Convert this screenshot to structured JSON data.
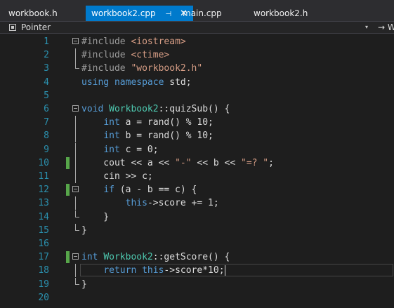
{
  "tabs": [
    {
      "label": "workbook.h",
      "active": false
    },
    {
      "label": "workbook2.cpp",
      "active": true,
      "pin": "⊣",
      "close": "✕"
    },
    {
      "label": "main.cpp",
      "active": false
    },
    {
      "label": "workbook2.h",
      "active": false
    }
  ],
  "navbar": {
    "scope_label": "Pointer",
    "dropdown_glyph": "▾",
    "right_label": "→ W"
  },
  "colors": {
    "accent": "#007acc",
    "background": "#1e1e1e",
    "line_number": "#2b91af",
    "keyword": "#569cd6",
    "type": "#4ec9b0",
    "string": "#d69d85",
    "preprocessor": "#9b9b9b",
    "change_marker": "#57a64a"
  },
  "icons": {
    "navbar_icon": "type-icon",
    "fold_icon": "collapse-icon",
    "tab_pin": "pin-icon",
    "tab_close": "close-icon"
  },
  "lines": [
    {
      "n": "1",
      "tokens": [
        {
          "t": "#include ",
          "c": "pp"
        },
        {
          "t": "<iostream>",
          "c": "str"
        }
      ],
      "fold": "box"
    },
    {
      "n": "2",
      "tokens": [
        {
          "t": "#include ",
          "c": "pp"
        },
        {
          "t": "<ctime>",
          "c": "str"
        }
      ],
      "fold": "line"
    },
    {
      "n": "3",
      "tokens": [
        {
          "t": "#include ",
          "c": "pp"
        },
        {
          "t": "\"workbook2.h\"",
          "c": "str"
        }
      ],
      "fold": "end"
    },
    {
      "n": "4",
      "tokens": [
        {
          "t": "using",
          "c": "kw"
        },
        {
          "t": " ",
          "c": "plain"
        },
        {
          "t": "namespace",
          "c": "kw"
        },
        {
          "t": " std;",
          "c": "plain"
        }
      ]
    },
    {
      "n": "5",
      "tokens": []
    },
    {
      "n": "6",
      "tokens": [
        {
          "t": "void",
          "c": "kw"
        },
        {
          "t": " ",
          "c": "plain"
        },
        {
          "t": "Workbook2",
          "c": "type"
        },
        {
          "t": "::quizSub() {",
          "c": "plain"
        }
      ],
      "fold": "box"
    },
    {
      "n": "7",
      "tokens": [
        {
          "t": "    ",
          "c": "plain"
        },
        {
          "t": "int",
          "c": "kw"
        },
        {
          "t": " a = rand() % 10;",
          "c": "plain"
        }
      ],
      "fold": "line"
    },
    {
      "n": "8",
      "tokens": [
        {
          "t": "    ",
          "c": "plain"
        },
        {
          "t": "int",
          "c": "kw"
        },
        {
          "t": " b = rand() % 10;",
          "c": "plain"
        }
      ],
      "fold": "line"
    },
    {
      "n": "9",
      "tokens": [
        {
          "t": "    ",
          "c": "plain"
        },
        {
          "t": "int",
          "c": "kw"
        },
        {
          "t": " c = 0;",
          "c": "plain"
        }
      ],
      "fold": "line"
    },
    {
      "n": "10",
      "tokens": [
        {
          "t": "    cout << a << ",
          "c": "plain"
        },
        {
          "t": "\"-\"",
          "c": "str"
        },
        {
          "t": " << b << ",
          "c": "plain"
        },
        {
          "t": "\"=? \"",
          "c": "str"
        },
        {
          "t": ";",
          "c": "plain"
        }
      ],
      "fold": "line",
      "changed": true
    },
    {
      "n": "11",
      "tokens": [
        {
          "t": "    cin >> c;",
          "c": "plain"
        }
      ],
      "fold": "line"
    },
    {
      "n": "12",
      "tokens": [
        {
          "t": "    ",
          "c": "plain"
        },
        {
          "t": "if",
          "c": "kw"
        },
        {
          "t": " (a - b == c) {",
          "c": "plain"
        }
      ],
      "fold": "box",
      "changed": true
    },
    {
      "n": "13",
      "tokens": [
        {
          "t": "        ",
          "c": "plain"
        },
        {
          "t": "this",
          "c": "kw"
        },
        {
          "t": "->score += 1;",
          "c": "plain"
        }
      ],
      "fold": "line"
    },
    {
      "n": "14",
      "tokens": [
        {
          "t": "    }",
          "c": "plain"
        }
      ],
      "fold": "end"
    },
    {
      "n": "15",
      "tokens": [
        {
          "t": "}",
          "c": "plain"
        }
      ],
      "fold": "end"
    },
    {
      "n": "16",
      "tokens": []
    },
    {
      "n": "17",
      "tokens": [
        {
          "t": "int",
          "c": "kw"
        },
        {
          "t": " ",
          "c": "plain"
        },
        {
          "t": "Workbook2",
          "c": "type"
        },
        {
          "t": "::getScore() {",
          "c": "plain"
        }
      ],
      "fold": "box",
      "changed": true
    },
    {
      "n": "18",
      "tokens": [
        {
          "t": "    ",
          "c": "plain"
        },
        {
          "t": "return",
          "c": "kw"
        },
        {
          "t": " ",
          "c": "plain"
        },
        {
          "t": "this",
          "c": "kw"
        },
        {
          "t": "->score*10;",
          "c": "plain"
        }
      ],
      "fold": "line",
      "current": true
    },
    {
      "n": "19",
      "tokens": [
        {
          "t": "}",
          "c": "plain"
        }
      ],
      "fold": "end"
    },
    {
      "n": "20",
      "tokens": []
    }
  ]
}
